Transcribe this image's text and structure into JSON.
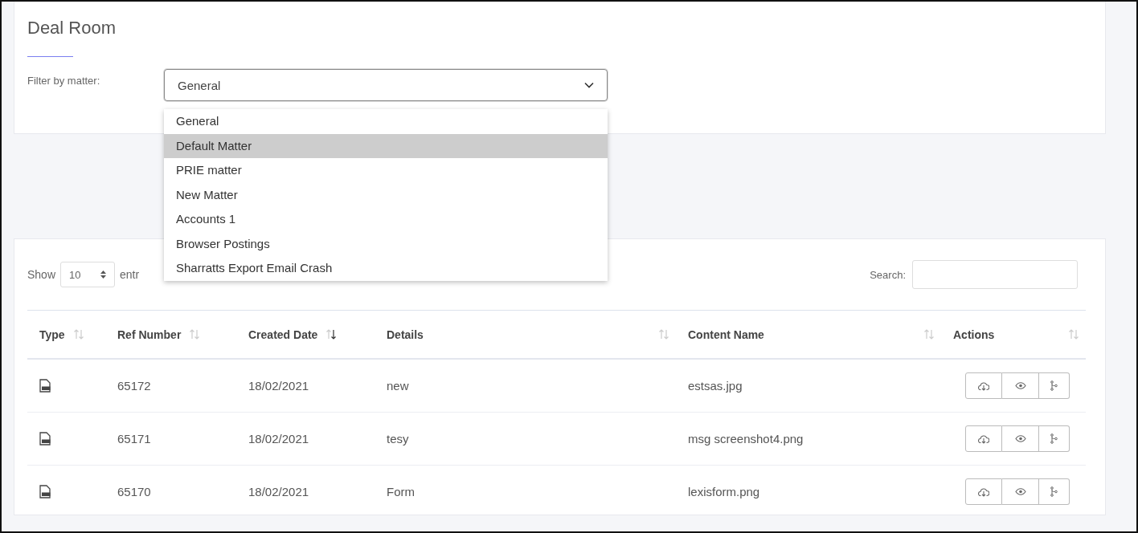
{
  "page": {
    "title": "Deal Room"
  },
  "filter": {
    "label": "Filter by matter:",
    "value": "General",
    "expanded": true,
    "options": [
      {
        "label": "General",
        "highlighted": false
      },
      {
        "label": "Default Matter",
        "highlighted": true
      },
      {
        "label": "PRIE matter",
        "highlighted": false
      },
      {
        "label": "New Matter",
        "highlighted": false
      },
      {
        "label": "Accounts 1",
        "highlighted": false
      },
      {
        "label": "Browser Postings",
        "highlighted": false
      },
      {
        "label": "Sharratts Export Email Crash",
        "highlighted": false
      }
    ]
  },
  "entries": {
    "show_label": "Show",
    "page_size": "10",
    "suffix": "entr"
  },
  "search": {
    "label": "Search:"
  },
  "table": {
    "columns": [
      {
        "label": "Type",
        "sorted_desc": false
      },
      {
        "label": "Ref Number",
        "sorted_desc": false
      },
      {
        "label": "Created Date",
        "sorted_desc": true
      },
      {
        "label": "Details",
        "sorted_desc": false
      },
      {
        "label": "Content Name",
        "sorted_desc": false
      },
      {
        "label": "Actions",
        "sorted_desc": false
      }
    ],
    "rows": [
      {
        "ref": "65172",
        "date": "18/02/2021",
        "details": "new",
        "content": "estsas.jpg"
      },
      {
        "ref": "65171",
        "date": "18/02/2021",
        "details": "tesy",
        "content": "msg screenshot4.png"
      },
      {
        "ref": "65170",
        "date": "18/02/2021",
        "details": "Form",
        "content": "lexisform.png"
      }
    ]
  }
}
